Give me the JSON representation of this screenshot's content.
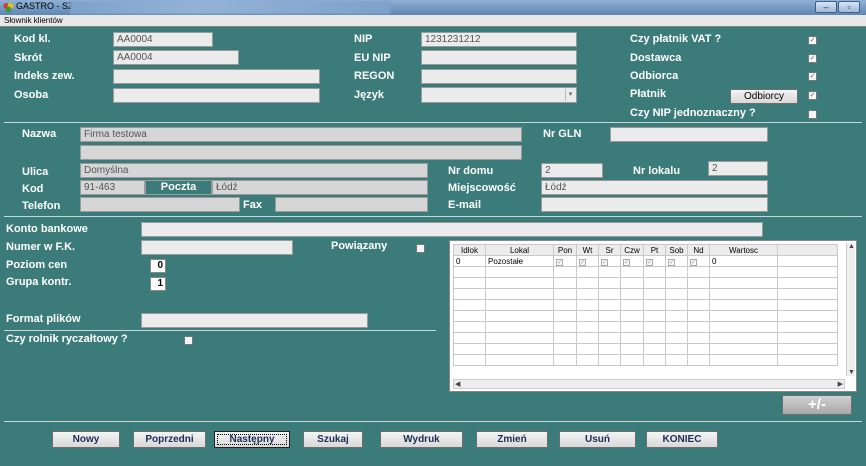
{
  "window": {
    "title": "GASTRO - SZEF",
    "menu": "Słownik klientów"
  },
  "top": {
    "kod_label": "Kod kl.",
    "kod_value": "AA0004",
    "skrot_label": "Skrót",
    "skrot_value": "AA0004",
    "indeks_label": "Indeks zew.",
    "indeks_value": "",
    "osoba_label": "Osoba",
    "osoba_value": "",
    "nip_label": "NIP",
    "nip_value": "1231231212",
    "eunip_label": "EU NIP",
    "eunip_value": "",
    "regon_label": "REGON",
    "regon_value": "",
    "jezyk_label": "Język",
    "jezyk_value": "",
    "vat_label": "Czy płatnik VAT ?",
    "dostawca_label": "Dostawca",
    "odbiorca_label": "Odbiorca",
    "platnik_label": "Płatnik",
    "odbiorcy_button": "Odbiorcy",
    "nipjedn_label": "Czy NIP jednoznaczny ?"
  },
  "address": {
    "nazwa_label": "Nazwa",
    "nazwa_value": "Firma testowa",
    "nazwa2_value": "",
    "gln_label": "Nr GLN",
    "gln_value": "",
    "ulica_label": "Ulica",
    "ulica_value": "Domyślna",
    "nrdomu_label": "Nr domu",
    "nrdomu_value": "2",
    "nrlokalu_label": "Nr lokalu",
    "nrlokalu_value": "2",
    "kod_label": "Kod",
    "kod_value": "91-463",
    "poczta_label": "Poczta",
    "poczta_value": "Łódź",
    "miejscowosc_label": "Miejscowość",
    "miejscowosc_value": "Łódź",
    "telefon_label": "Telefon",
    "telefon_value": "",
    "fax_label": "Fax",
    "fax_value": "",
    "email_label": "E-mail",
    "email_value": ""
  },
  "lower": {
    "konto_label": "Konto bankowe",
    "konto_value": "",
    "numerfk_label": "Numer w F.K.",
    "numerfk_value": "",
    "powiazany_label": "Powiązany",
    "poziom_label": "Poziom cen",
    "poziom_value": "0",
    "grupa_label": "Grupa kontr.",
    "grupa_value": "1",
    "format_label": "Format plików",
    "format_value": "",
    "rolnik_label": "Czy rolnik ryczałtowy ?",
    "plusminus": "+/-"
  },
  "grid": {
    "columns": [
      "Idlok",
      "Lokal",
      "Pon",
      "Wt",
      "Sr",
      "Czw",
      "Pt",
      "Sob",
      "Nd",
      "Wartosc"
    ],
    "row": {
      "idlok": "0",
      "lokal": "Pozostałe",
      "wartosc": "0"
    }
  },
  "buttons": {
    "nowy": "Nowy",
    "poprzedni": "Poprzedni",
    "nastepny": "Następny",
    "szukaj": "Szukaj",
    "wydruk": "Wydruk",
    "zmien": "Zmień",
    "usun": "Usuń",
    "koniec": "KONIEC"
  },
  "colors": {
    "background": "#3b7c7a",
    "field": "#ebebeb",
    "label": "#ffffff",
    "button_text": "#1b2d55"
  }
}
